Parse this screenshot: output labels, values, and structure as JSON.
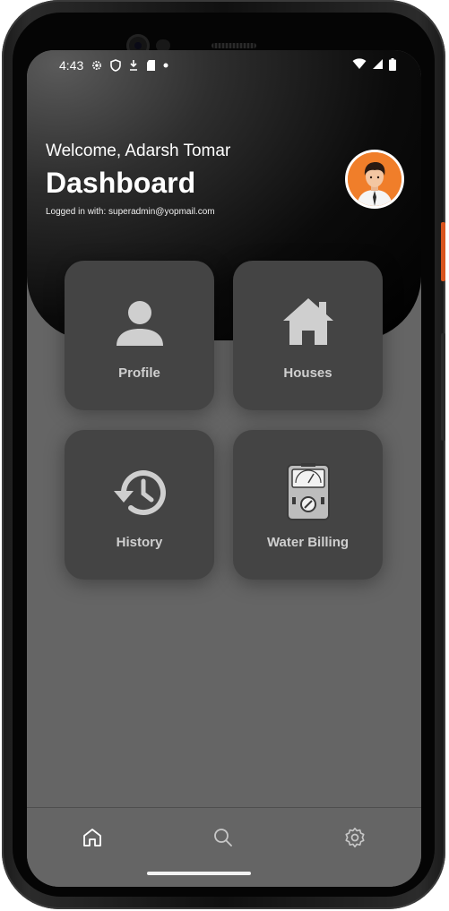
{
  "status_bar": {
    "time": "4:43"
  },
  "header": {
    "welcome": "Welcome, Adarsh Tomar",
    "title": "Dashboard",
    "logged_in": "Logged in with: superadmin@yopmail.com"
  },
  "cards": {
    "profile": "Profile",
    "houses": "Houses",
    "history": "History",
    "water_billing": "Water Billing"
  },
  "nav": {
    "items": [
      "home-icon",
      "search-icon",
      "settings-icon"
    ]
  },
  "colors": {
    "screen_bg": "#656565",
    "card_bg": "#444444",
    "avatar_bg": "#f07e2a"
  }
}
